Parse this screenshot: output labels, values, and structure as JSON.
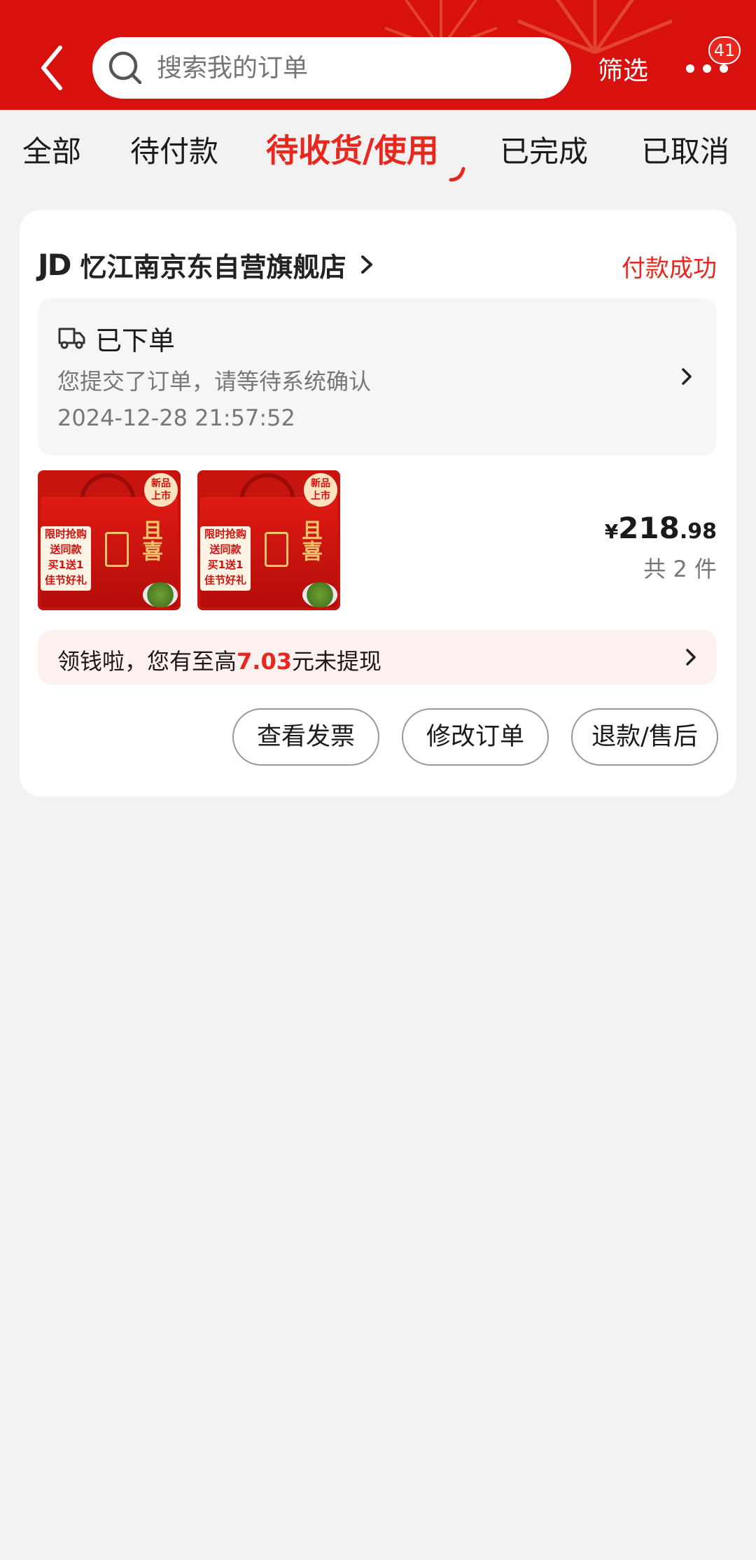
{
  "header": {
    "search_placeholder": "搜索我的订单",
    "filter_label": "筛选",
    "notification_count": "41",
    "accent_color": "#d9110e"
  },
  "tabs": [
    {
      "label": "全部",
      "active": false
    },
    {
      "label": "待付款",
      "active": false
    },
    {
      "label": "待收货/使用",
      "active": true
    },
    {
      "label": "已完成",
      "active": false
    },
    {
      "label": "已取消",
      "active": false
    }
  ],
  "order": {
    "store_logo": "JD",
    "store_name": "忆江南京东自营旗舰店",
    "pay_status": "付款成功",
    "status_title": "已下单",
    "status_desc": "您提交了订单，请等待系统确认",
    "status_time": "2024-12-28 21:57:52",
    "products": [
      {
        "promo_lines": [
          "限时抢购",
          "送同款",
          "买1送1",
          "佳节好礼"
        ],
        "new_tag": [
          "新品",
          "上市"
        ]
      },
      {
        "promo_lines": [
          "限时抢购",
          "送同款",
          "买1送1",
          "佳节好礼"
        ],
        "new_tag": [
          "新品",
          "上市"
        ]
      }
    ],
    "price_currency": "¥",
    "price_int": "218",
    "price_dec": ".98",
    "quantity": "共 2 件",
    "cash_prefix": "领钱啦，您有至高",
    "cash_amount": "7.03",
    "cash_suffix": "元未提现",
    "buttons": {
      "invoice": "查看发票",
      "modify": "修改订单",
      "refund": "退款/售后"
    }
  }
}
